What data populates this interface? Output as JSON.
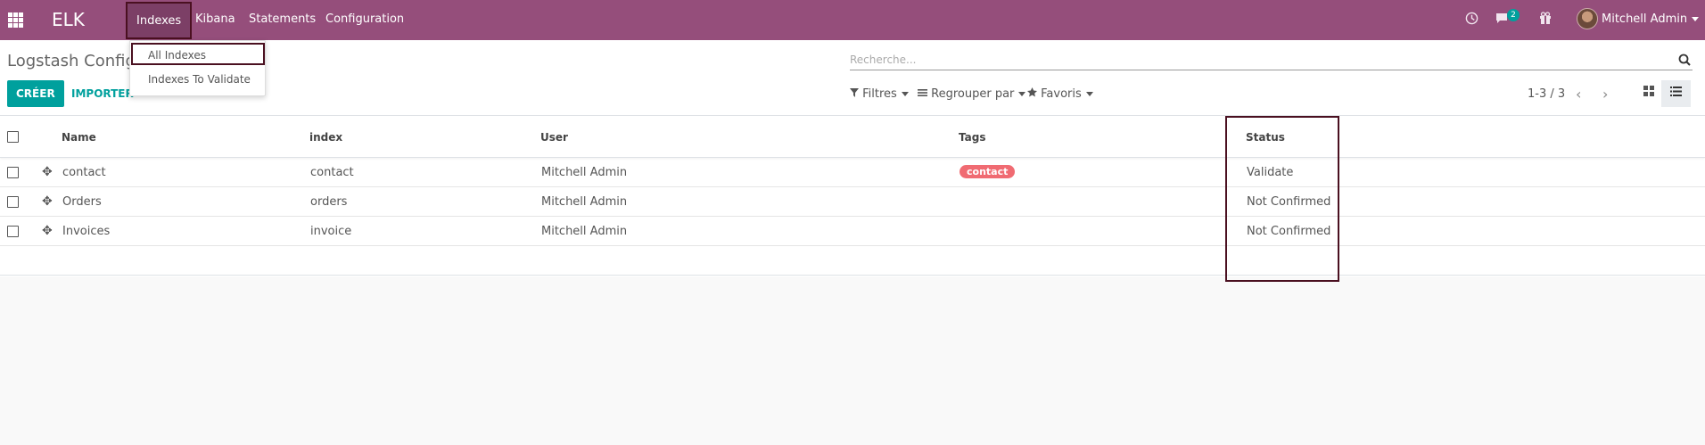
{
  "navbar": {
    "brand": "ELK",
    "menu": [
      "Indexes",
      "Kibana",
      "Statements",
      "Configuration"
    ],
    "messages_count": "2",
    "user_name": "Mitchell Admin"
  },
  "control_panel": {
    "breadcrumb": "Logstash Config",
    "create_label": "CRÉER",
    "import_label": "IMPORTER",
    "search_placeholder": "Recherche...",
    "filters_label": "Filtres",
    "group_by_label": "Regrouper par",
    "favorites_label": "Favoris",
    "pager": "1-3 / 3"
  },
  "dropdown": {
    "items": [
      "All Indexes",
      "Indexes To Validate"
    ]
  },
  "table": {
    "headers": [
      "Name",
      "index",
      "User",
      "Tags",
      "Status"
    ],
    "rows": [
      {
        "name": "contact",
        "index": "contact",
        "user": "Mitchell Admin",
        "tag": "contact",
        "status": "Validate"
      },
      {
        "name": "Orders",
        "index": "orders",
        "user": "Mitchell Admin",
        "tag": "",
        "status": "Not Confirmed"
      },
      {
        "name": "Invoices",
        "index": "invoice",
        "user": "Mitchell Admin",
        "tag": "",
        "status": "Not Confirmed"
      }
    ]
  },
  "colors": {
    "navbar": "#954e7b",
    "primary": "#00a09d",
    "tag": "#f06b72",
    "highlight_outline": "#4a1020"
  }
}
